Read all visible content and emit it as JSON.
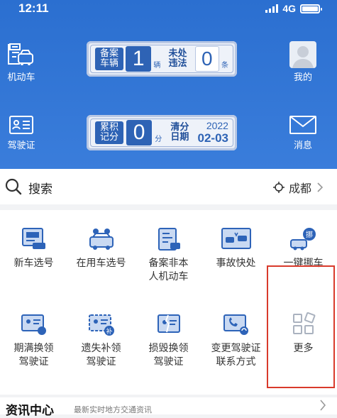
{
  "status": {
    "time": "12:11",
    "network": "4G"
  },
  "header": {
    "vehicle_label": "机动车",
    "license_label": "驾驶证",
    "mine_label": "我的",
    "message_label": "消息",
    "vehicle_panel": {
      "registered_label": "备案\n车辆",
      "registered_count": "1",
      "registered_unit": "辆",
      "violation_label": "未处\n违法",
      "violation_count": "0",
      "violation_unit": "条"
    },
    "license_panel": {
      "points_label": "累积\n记分",
      "points_value": "0",
      "points_unit": "分",
      "clear_label": "清分\n日期",
      "clear_year": "2022",
      "clear_date": "02-03"
    }
  },
  "search": {
    "label": "搜索",
    "location": "成都"
  },
  "services": [
    {
      "label": "新车选号",
      "icon": "new-car-plate-icon"
    },
    {
      "label": "在用车选号",
      "icon": "used-car-plate-icon"
    },
    {
      "label": "备案非本\n人机动车",
      "icon": "register-other-vehicle-icon"
    },
    {
      "label": "事故快处",
      "icon": "accident-icon"
    },
    {
      "label": "一键挪车",
      "icon": "move-car-icon"
    },
    {
      "label": "期满换领\n驾驶证",
      "icon": "license-renew-icon"
    },
    {
      "label": "遗失补领\n驾驶证",
      "icon": "license-lost-icon"
    },
    {
      "label": "损毁换领\n驾驶证",
      "icon": "license-damaged-icon"
    },
    {
      "label": "变更驾驶证\n联系方式",
      "icon": "license-contact-icon"
    },
    {
      "label": "更多",
      "icon": "more-grid-icon"
    }
  ],
  "news": {
    "title": "资讯中心",
    "subtitle": "最新实时地方交通资讯"
  },
  "colors": {
    "brand": "#2b6fd0",
    "highlight": "#d93a2b"
  }
}
